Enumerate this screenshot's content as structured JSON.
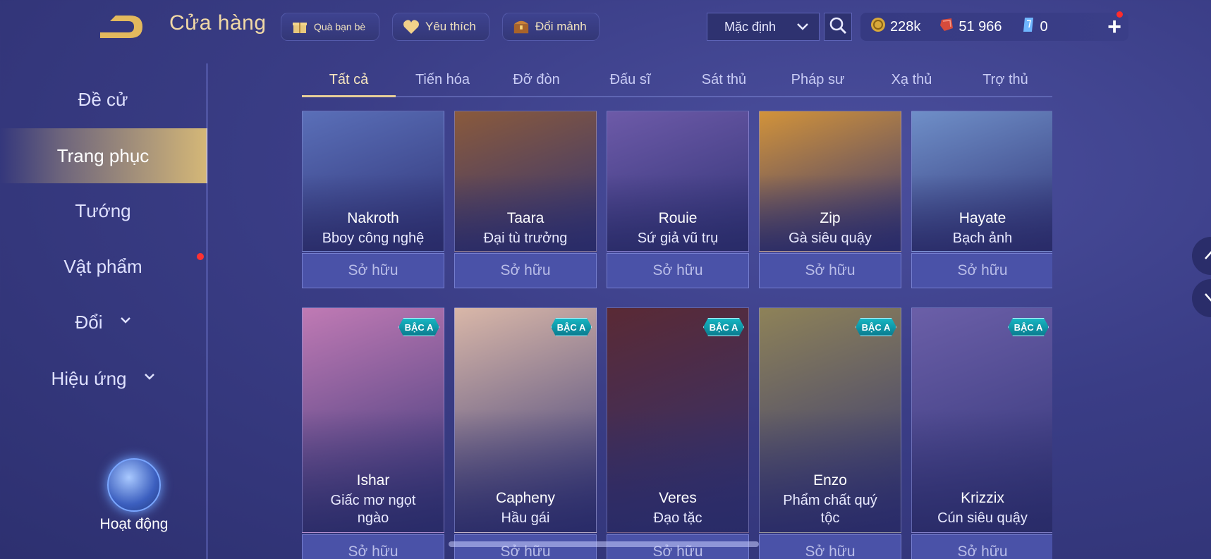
{
  "header": {
    "title": "Cửa hàng",
    "gift_label": "Quà bạn bè",
    "favorite_label": "Yêu thích",
    "shard_label": "Đổi mảnh",
    "sort_value": "Mặc định",
    "currencies": {
      "gold": "228k",
      "vouchers": "51 966",
      "diamonds": "0"
    },
    "plus": "+"
  },
  "sidebar": {
    "items": [
      {
        "label": "Đề cử"
      },
      {
        "label": "Trang phục"
      },
      {
        "label": "Tướng"
      },
      {
        "label": "Vật phẩm"
      },
      {
        "label": "Đổi"
      },
      {
        "label": "Hiệu ứng"
      }
    ],
    "event_label": "Hoạt động"
  },
  "tabs": [
    {
      "label": "Tất cả"
    },
    {
      "label": "Tiến hóa"
    },
    {
      "label": "Đỡ đòn"
    },
    {
      "label": "Đấu sĩ"
    },
    {
      "label": "Sát thủ"
    },
    {
      "label": "Pháp sư"
    },
    {
      "label": "Xạ thủ"
    },
    {
      "label": "Trợ thủ"
    }
  ],
  "cards_row1": [
    {
      "hero": "Nakroth",
      "skin": "Bboy công nghệ",
      "status": "Sở hữu",
      "color": "#5a6fb8"
    },
    {
      "hero": "Taara",
      "skin": "Đại tù trưởng",
      "status": "Sở hữu",
      "color": "#8a5a3c"
    },
    {
      "hero": "Rouie",
      "skin": "Sứ giả vũ trụ",
      "status": "Sở hữu",
      "color": "#6d5aa8"
    },
    {
      "hero": "Zip",
      "skin": "Gà siêu quậy",
      "status": "Sở hữu",
      "color": "#d2933a"
    },
    {
      "hero": "Hayate",
      "skin": "Bạch ảnh",
      "status": "Sở hữu",
      "color": "#6f8fc8"
    }
  ],
  "cards_row2": [
    {
      "hero": "Ishar",
      "skin_line1": "Giấc mơ ngọt",
      "skin_line2": "ngào",
      "badge": "BẬC A",
      "status": "Sở hữu",
      "color": "#c07ab4"
    },
    {
      "hero": "Capheny",
      "skin_line1": "Hầu gái",
      "skin_line2": "",
      "badge": "BẬC A",
      "status": "Sở hữu",
      "color": "#d9b7a8"
    },
    {
      "hero": "Veres",
      "skin_line1": "Đạo tặc",
      "skin_line2": "",
      "badge": "BẬC A",
      "status": "Sở hữu",
      "color": "#5a2a35"
    },
    {
      "hero": "Enzo",
      "skin_line1": "Phẩm chất quý",
      "skin_line2": "tộc",
      "badge": "BẬC A",
      "status": "Sở hữu",
      "color": "#8e8258"
    },
    {
      "hero": "Krizzix",
      "skin_line1": "Cún siêu quậy",
      "skin_line2": "",
      "badge": "BẬC A",
      "status": "Sở hữu",
      "color": "#6b5fa8"
    }
  ]
}
